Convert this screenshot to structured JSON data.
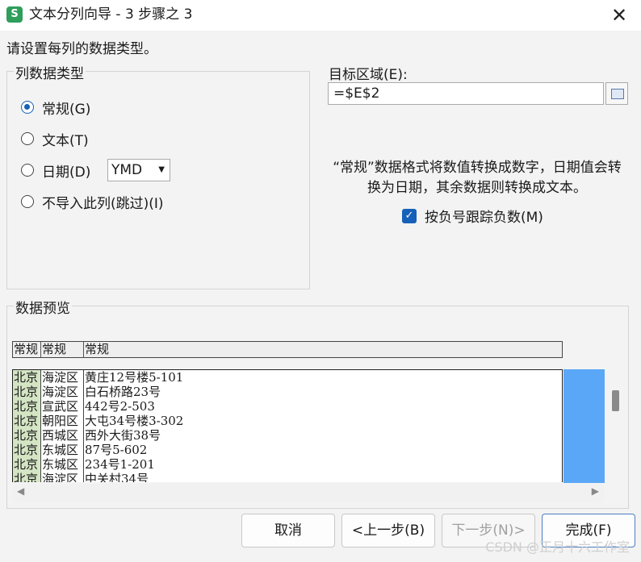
{
  "window": {
    "title": "文本分列向导 - 3 步骤之 3",
    "icon_letter": "S",
    "close_symbol": "✕"
  },
  "instruction": "请设置每列的数据类型。",
  "column_type": {
    "group_label": "列数据类型",
    "options": [
      {
        "label": "常规(G)",
        "checked": true
      },
      {
        "label": "文本(T)",
        "checked": false
      },
      {
        "label": "日期(D)",
        "checked": false
      },
      {
        "label": "不导入此列(跳过)(I)",
        "checked": false
      }
    ],
    "date_format": "YMD"
  },
  "destination": {
    "label": "目标区域(E):",
    "value": "=$E$2"
  },
  "description": "“常规”数据格式将数值转换成数字，日期值会转换为日期，其余数据则转换成文本。",
  "negative_checkbox": {
    "label": "按负号跟踪负数(M)",
    "checked": true
  },
  "preview": {
    "group_label": "数据预览",
    "headers": [
      "常规",
      "常规",
      "常规"
    ],
    "rows": [
      [
        "北京",
        "海淀区",
        "黄庄12号楼5-101"
      ],
      [
        "北京",
        "海淀区",
        "白石桥路23号"
      ],
      [
        "北京",
        "宣武区",
        "442号2-503"
      ],
      [
        "北京",
        "朝阳区",
        "大屯34号楼3-302"
      ],
      [
        "北京",
        "西城区",
        "西外大街38号"
      ],
      [
        "北京",
        "东城区",
        "87号5-602"
      ],
      [
        "北京",
        "东城区",
        "234号1-201"
      ],
      [
        "北京",
        "海淀区",
        "中关村34号"
      ]
    ]
  },
  "buttons": {
    "cancel": "取消",
    "back": "<上一步(B)",
    "next": "下一步(N)>",
    "finish": "完成(F)"
  },
  "watermark": "CSDN @正月十六工作室"
}
